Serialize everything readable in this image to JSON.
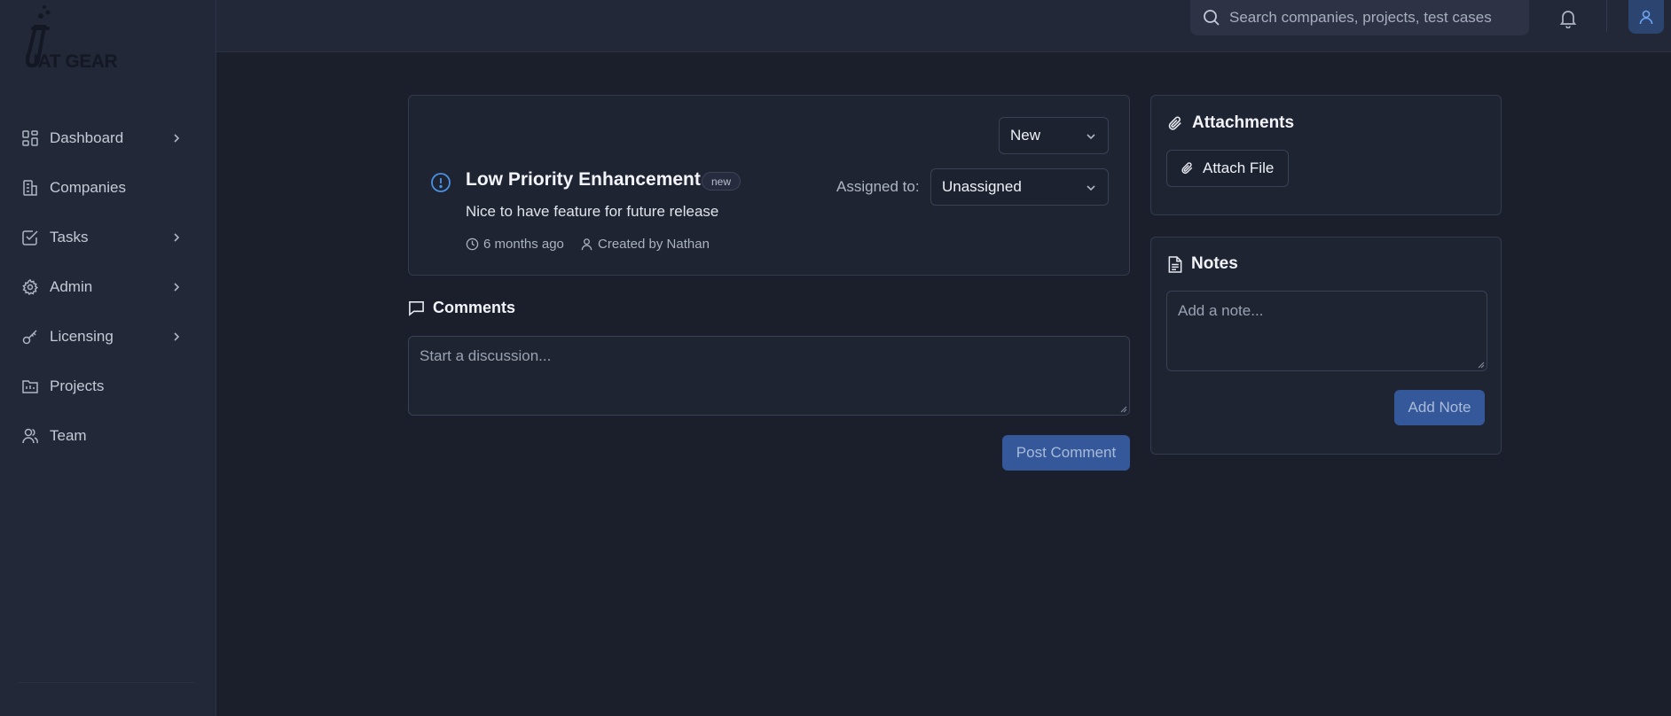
{
  "app": {
    "logo_text": "UAT GEAR"
  },
  "sidebar": {
    "items": [
      {
        "label": "Dashboard",
        "icon": "dashboard-icon",
        "has_children": true
      },
      {
        "label": "Companies",
        "icon": "building-icon",
        "has_children": false
      },
      {
        "label": "Tasks",
        "icon": "checkbox-icon",
        "has_children": true
      },
      {
        "label": "Admin",
        "icon": "gear-icon",
        "has_children": true
      },
      {
        "label": "Licensing",
        "icon": "key-icon",
        "has_children": true
      },
      {
        "label": "Projects",
        "icon": "folder-icon",
        "has_children": false
      },
      {
        "label": "Team",
        "icon": "users-icon",
        "has_children": false
      }
    ]
  },
  "header": {
    "search_placeholder": "Search companies, projects, test cases"
  },
  "issue": {
    "status": "New",
    "title": "Low Priority Enhancement",
    "badge": "new",
    "description": "Nice to have feature for future release",
    "time_ago": "6 months ago",
    "created_by": "Created by Nathan",
    "assigned_label": "Assigned to:",
    "assignee": "Unassigned"
  },
  "comments": {
    "title": "Comments",
    "placeholder": "Start a discussion...",
    "post_label": "Post Comment"
  },
  "attachments": {
    "title": "Attachments",
    "attach_label": "Attach File"
  },
  "notes": {
    "title": "Notes",
    "placeholder": "Add a note...",
    "add_label": "Add Note"
  },
  "colors": {
    "background": "#1b1e2b",
    "sidebar": "#232838",
    "accent": "#34589a",
    "info_icon": "#4a90e2"
  }
}
